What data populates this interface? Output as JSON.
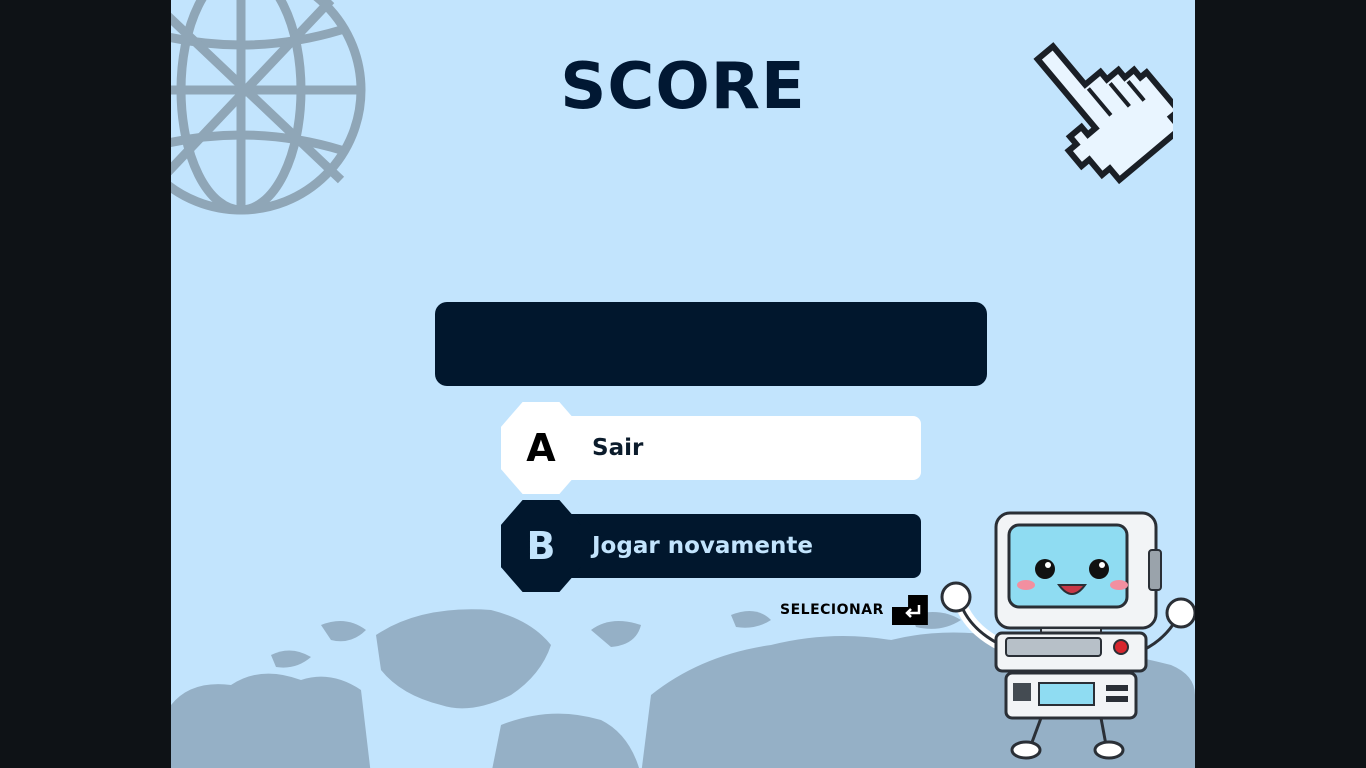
{
  "screen": {
    "title": "SCORE",
    "score_value": ""
  },
  "options": [
    {
      "key": "A",
      "label": "Sair"
    },
    {
      "key": "B",
      "label": "Jogar novamente"
    }
  ],
  "hint": {
    "label": "SELECIONAR",
    "key_icon": "enter-key-icon"
  },
  "colors": {
    "background": "#c2e4fd",
    "frame": "#0e1216",
    "dark_navy": "#01172d",
    "option_light": "#ffffff",
    "decor_gray": "#8fa6b7"
  },
  "decorations": [
    "globe-icon",
    "pixel-hand-cursor-icon",
    "world-map",
    "computer-robot-mascot"
  ]
}
